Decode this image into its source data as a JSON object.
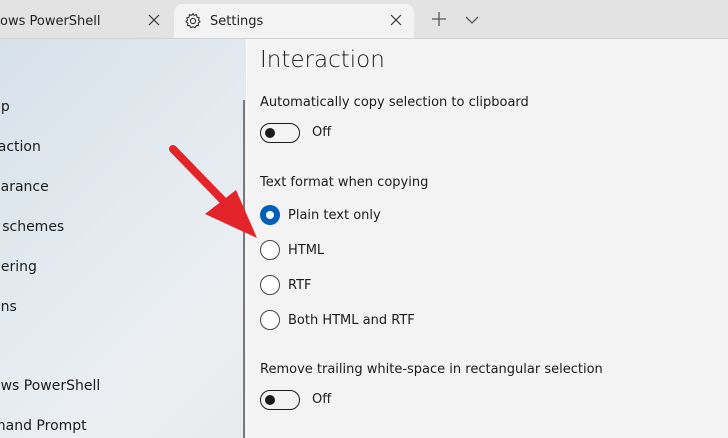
{
  "tabs": {
    "powershell": {
      "label": "ows PowerShell"
    },
    "settings": {
      "label": "Settings"
    }
  },
  "sidebar": {
    "items": [
      {
        "label": "up"
      },
      {
        "label": "raction"
      },
      {
        "label": "earance"
      },
      {
        "label": "r schemes"
      },
      {
        "label": "dering"
      },
      {
        "label": "ons"
      },
      {
        "label": "ows PowerShell"
      },
      {
        "label": "mand Prompt"
      }
    ]
  },
  "main": {
    "title": "Interaction",
    "copy_on_select": {
      "label": "Automatically copy selection to clipboard",
      "state": "Off"
    },
    "text_format": {
      "label": "Text format when copying",
      "options": [
        {
          "label": "Plain text only",
          "checked": true
        },
        {
          "label": "HTML",
          "checked": false
        },
        {
          "label": "RTF",
          "checked": false
        },
        {
          "label": "Both HTML and RTF",
          "checked": false
        }
      ]
    },
    "trim_block": {
      "label": "Remove trailing white-space in rectangular selection",
      "state": "Off"
    }
  },
  "colors": {
    "accent": "#005fb8",
    "annotation_arrow": "#e3242b"
  }
}
